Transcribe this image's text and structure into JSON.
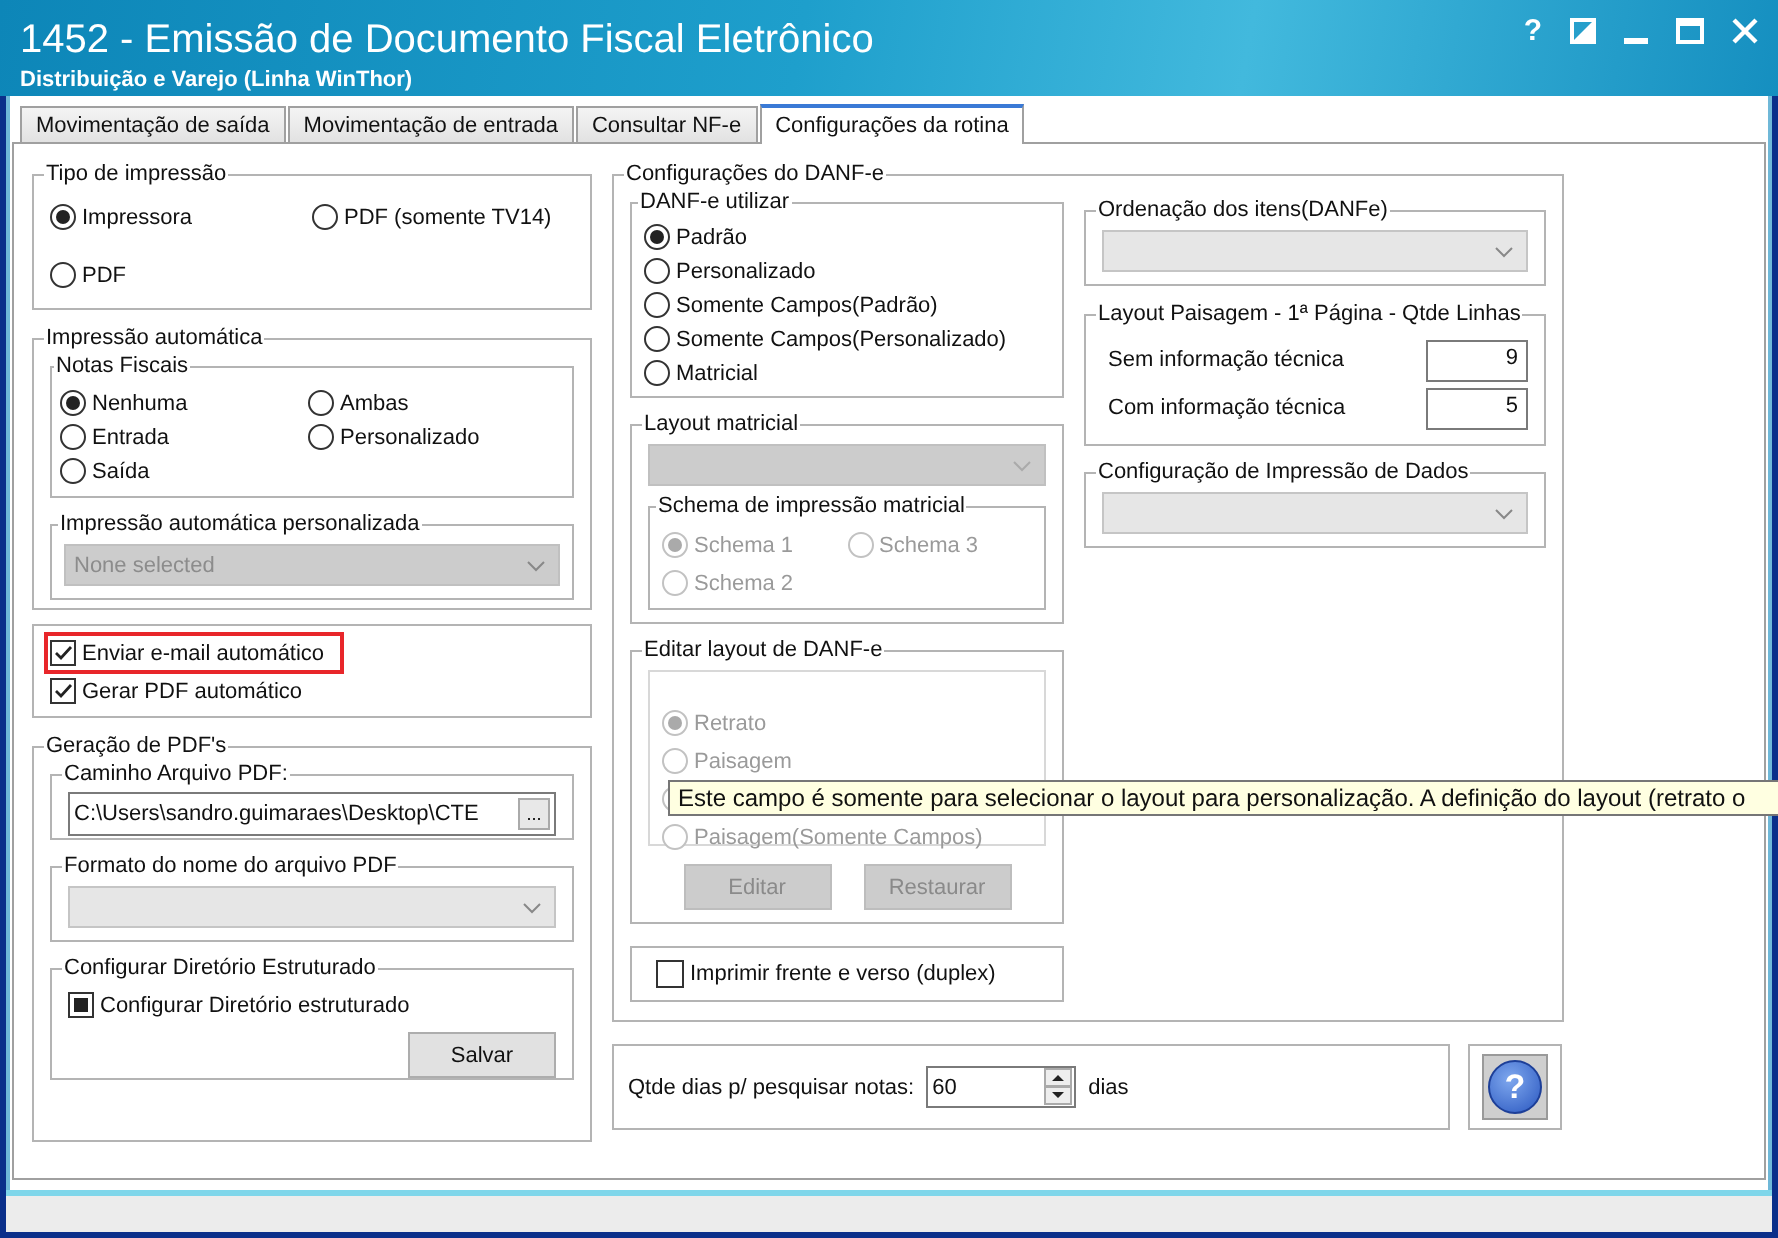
{
  "window": {
    "title": "1452 - Emissão de Documento Fiscal Eletrônico",
    "subtitle": "Distribuição e Varejo (Linha WinThor)",
    "help_glyph": "?"
  },
  "tabs": [
    {
      "label": "Movimentação de saída",
      "selected": false
    },
    {
      "label": "Movimentação de entrada",
      "selected": false
    },
    {
      "label": "Consultar NF-e",
      "selected": false
    },
    {
      "label": "Configurações da rotina",
      "selected": true
    }
  ],
  "tipo_impressao": {
    "title": "Tipo de impressão",
    "options": [
      {
        "label": "Impressora",
        "selected": true
      },
      {
        "label": "PDF (somente TV14)",
        "selected": false
      },
      {
        "label": "PDF",
        "selected": false
      }
    ]
  },
  "impressao_automatica": {
    "title": "Impressão automática",
    "notas_fiscais": {
      "title": "Notas Fiscais",
      "options": [
        {
          "label": "Nenhuma",
          "selected": true
        },
        {
          "label": "Ambas",
          "selected": false
        },
        {
          "label": "Entrada",
          "selected": false
        },
        {
          "label": "Personalizado",
          "selected": false
        },
        {
          "label": "Saída",
          "selected": false
        }
      ]
    },
    "personalizada": {
      "title": "Impressão automática personalizada",
      "placeholder": "None selected",
      "disabled": true
    }
  },
  "email_options": [
    {
      "label": "Enviar e-mail automático",
      "checked": true,
      "highlighted": true
    },
    {
      "label": "Gerar PDF automático",
      "checked": true,
      "highlighted": false
    }
  ],
  "geracao_pdf": {
    "title": "Geração de PDF's",
    "caminho": {
      "title": "Caminho Arquivo PDF:",
      "value": "C:\\Users\\sandro.guimaraes\\Desktop\\CTE",
      "browse_glyph": "..."
    },
    "formato": {
      "title": "Formato do nome do arquivo PDF",
      "disabled": false
    },
    "diretorio": {
      "title": "Configurar Diretório Estruturado",
      "checkbox": {
        "label": "Configurar Diretório estruturado",
        "indeterminate": true
      },
      "save_button": "Salvar"
    }
  },
  "danfe": {
    "title": "Configurações do DANF-e",
    "utilizar": {
      "title": "DANF-e utilizar",
      "options": [
        {
          "label": "Padrão",
          "selected": true
        },
        {
          "label": "Personalizado",
          "selected": false
        },
        {
          "label": "Somente Campos(Padrão)",
          "selected": false
        },
        {
          "label": "Somente Campos(Personalizado)",
          "selected": false
        },
        {
          "label": "Matricial",
          "selected": false
        }
      ]
    },
    "layout_matricial": {
      "title": "Layout matricial",
      "disabled": true,
      "schema": {
        "title": "Schema de impressão matricial",
        "options": [
          {
            "label": "Schema 1",
            "selected": true
          },
          {
            "label": "Schema 3",
            "selected": false
          },
          {
            "label": "Schema 2",
            "selected": false
          }
        ]
      }
    },
    "editar_layout": {
      "title": "Editar layout de DANF-e",
      "disabled": true,
      "options": [
        {
          "kind": "option",
          "label": "Retrato",
          "selected": true
        },
        {
          "kind": "option",
          "label": "Paisagem",
          "selected": false
        },
        {
          "kind": "covered"
        },
        {
          "kind": "option",
          "label": "Paisagem(Somente Campos)",
          "selected": false
        }
      ],
      "buttons": [
        "Editar",
        "Restaurar"
      ]
    },
    "duplex": {
      "label": "Imprimir frente e verso (duplex)",
      "checked": false
    },
    "ordenacao": {
      "title": "Ordenação dos itens(DANFe)",
      "disabled": false
    },
    "layout_paisagem": {
      "title": "Layout Paisagem - 1ª Página - Qtde Linhas",
      "rows": [
        {
          "label": "Sem informação técnica",
          "value": "9"
        },
        {
          "label": "Com informação técnica",
          "value": "5"
        }
      ]
    },
    "config_impressao": {
      "title": "Configuração de Impressão de Dados",
      "disabled": false
    }
  },
  "qtde_dias": {
    "label": "Qtde dias p/ pesquisar notas:",
    "value": "60",
    "unit": "dias"
  },
  "help_button": "?",
  "tooltip": "Este campo é somente para selecionar o layout para personalização. A definição do layout  (retrato o"
}
